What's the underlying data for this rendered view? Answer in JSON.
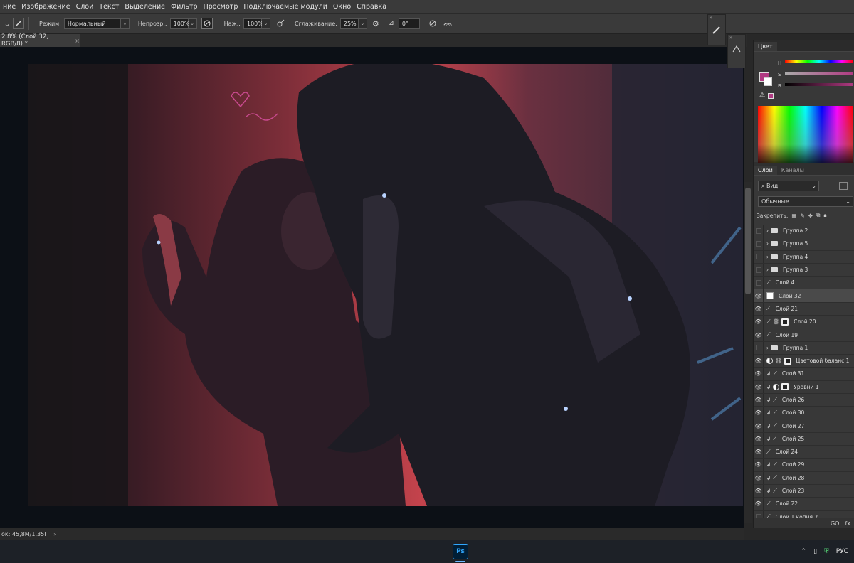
{
  "menu": [
    "ние",
    "Изображение",
    "Слои",
    "Текст",
    "Выделение",
    "Фильтр",
    "Просмотр",
    "Подключаемые модули",
    "Окно",
    "Справка"
  ],
  "options": {
    "mode_label": "Режим:",
    "mode_value": "Нормальный",
    "opacity_label": "Непрозр.:",
    "opacity_value": "100%",
    "flow_label": "Наж.:",
    "flow_value": "100%",
    "smoothing_label": "Сглаживание:",
    "smoothing_value": "25%",
    "angle_value": "0°"
  },
  "document": {
    "tab_title": "2,8% (Слой 32, RGB/8) *",
    "close": "×"
  },
  "status": {
    "doc_size": "ок: 45,8M/1,35Г",
    "arrow": "›"
  },
  "panels": {
    "color_tab": "Цвет",
    "color_sliders": [
      "H",
      "S",
      "B"
    ],
    "layers_tab": "Слои",
    "channels_tab": "Каналы",
    "search_kind": "Вид",
    "blend_mode": "Обычные",
    "lock_label": "Закрепить:"
  },
  "layers": [
    {
      "name": "Группа 2",
      "type": "group",
      "visible": false,
      "selected": false
    },
    {
      "name": "Группа 5",
      "type": "group",
      "visible": false,
      "selected": false
    },
    {
      "name": "Группа 4",
      "type": "group",
      "visible": false,
      "selected": false
    },
    {
      "name": "Группа 3",
      "type": "group",
      "visible": false,
      "selected": false
    },
    {
      "name": "Слой 4",
      "type": "layer",
      "visible": false,
      "selected": false
    },
    {
      "name": "Слой 32",
      "type": "layer",
      "visible": true,
      "selected": true
    },
    {
      "name": "Слой 21",
      "type": "layer",
      "visible": true,
      "selected": false
    },
    {
      "name": "Слой 20",
      "type": "masked",
      "visible": true,
      "selected": false
    },
    {
      "name": "Слой 19",
      "type": "layer",
      "visible": true,
      "selected": false
    },
    {
      "name": "Группа 1",
      "type": "group",
      "visible": false,
      "selected": false
    },
    {
      "name": "Цветовой баланс 1",
      "type": "adjust",
      "visible": true,
      "selected": false
    },
    {
      "name": "Слой 31",
      "type": "clip",
      "visible": true,
      "selected": false
    },
    {
      "name": "Уровни 1",
      "type": "adjust-clip",
      "visible": true,
      "selected": false
    },
    {
      "name": "Слой 26",
      "type": "clip",
      "visible": true,
      "selected": false
    },
    {
      "name": "Слой 30",
      "type": "clip",
      "visible": true,
      "selected": false
    },
    {
      "name": "Слой 27",
      "type": "clip",
      "visible": true,
      "selected": false
    },
    {
      "name": "Слой 25",
      "type": "clip",
      "visible": true,
      "selected": false
    },
    {
      "name": "Слой 24",
      "type": "layer",
      "visible": true,
      "selected": false
    },
    {
      "name": "Слой 29",
      "type": "clip",
      "visible": true,
      "selected": false
    },
    {
      "name": "Слой 28",
      "type": "clip",
      "visible": true,
      "selected": false
    },
    {
      "name": "Слой 23",
      "type": "clip",
      "visible": true,
      "selected": false
    },
    {
      "name": "Слой 22",
      "type": "layer",
      "visible": true,
      "selected": false
    },
    {
      "name": "Слой 1 копия 2",
      "type": "layer",
      "visible": false,
      "selected": false
    }
  ],
  "layer_footer": [
    "GO",
    "fx"
  ],
  "taskbar": {
    "app_icon": "Ps",
    "language": "РУС",
    "tray_chevron": "⌃"
  },
  "colors": {
    "foreground": "#b03a82",
    "background": "#ffffff",
    "accent": "#31a8ff"
  }
}
